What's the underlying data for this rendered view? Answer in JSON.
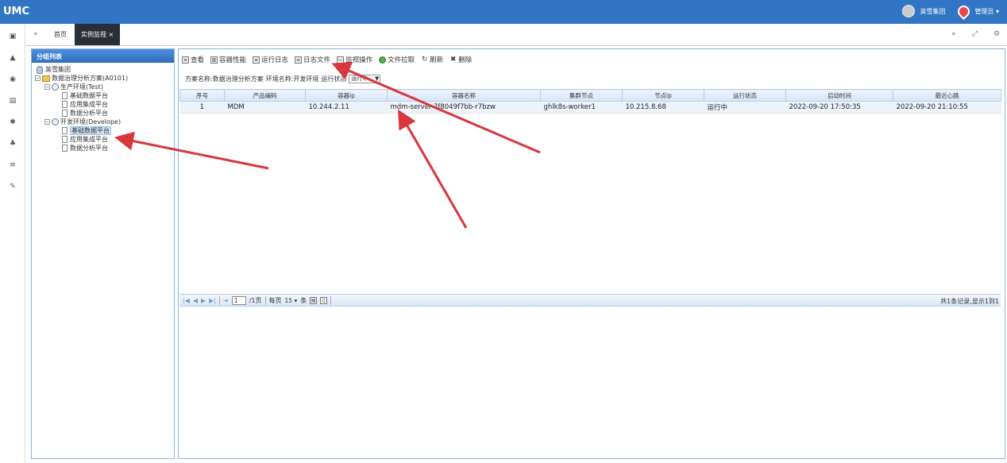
{
  "app": {
    "logo": "UMC"
  },
  "topbar": {
    "group_label": "英雪集团",
    "user_label": "管理员 ▾"
  },
  "tabs": {
    "home": "首页",
    "active": "实例监视 ×"
  },
  "left_panel": {
    "title": "分组列表",
    "tree": {
      "root": "英雪集团",
      "scheme": "数据治理分析方案(A0101)",
      "env_prod": "生产环境(Test)",
      "prod_items": [
        "基础数据平台",
        "应用集成平台",
        "数据分析平台"
      ],
      "env_dev": "开发环境(Develope)",
      "dev_items": [
        "基础数据平台",
        "应用集成平台",
        "数据分析平台"
      ]
    }
  },
  "toolbar": [
    "查看",
    "容器性能",
    "运行日志",
    "日志文件",
    "监视操作",
    "文件拉取",
    "刷新",
    "删除"
  ],
  "filter": {
    "scheme_label": "方案名称:数据治理分析方案",
    "env_label": "环境名称:开发环境",
    "status_label": "运行状态",
    "status_value": "运行中"
  },
  "grid": {
    "columns": [
      "序号",
      "产品编码",
      "容器ip",
      "容器名称",
      "集群节点",
      "节点ip",
      "运行状态",
      "启动时间",
      "最近心跳"
    ],
    "rows": [
      [
        "1",
        "MDM",
        "10.244.2.11",
        "mdm-server-7f8049f7bb-r7bzw",
        "ghlk8s-worker1",
        "10.215.8.68",
        "运行中",
        "2022-09-20 17:50:35",
        "2022-09-20 21:10:55"
      ]
    ]
  },
  "pager": {
    "page": "1",
    "of_pages": "/1页",
    "per_page_label": "每页",
    "per_page": "15",
    "unit": "条",
    "summary": "共1条记录,显示1到1"
  },
  "colors": {
    "topbar": "#3175c4",
    "arrow": "#d9363e",
    "header_blue": "#2d6fbf"
  }
}
